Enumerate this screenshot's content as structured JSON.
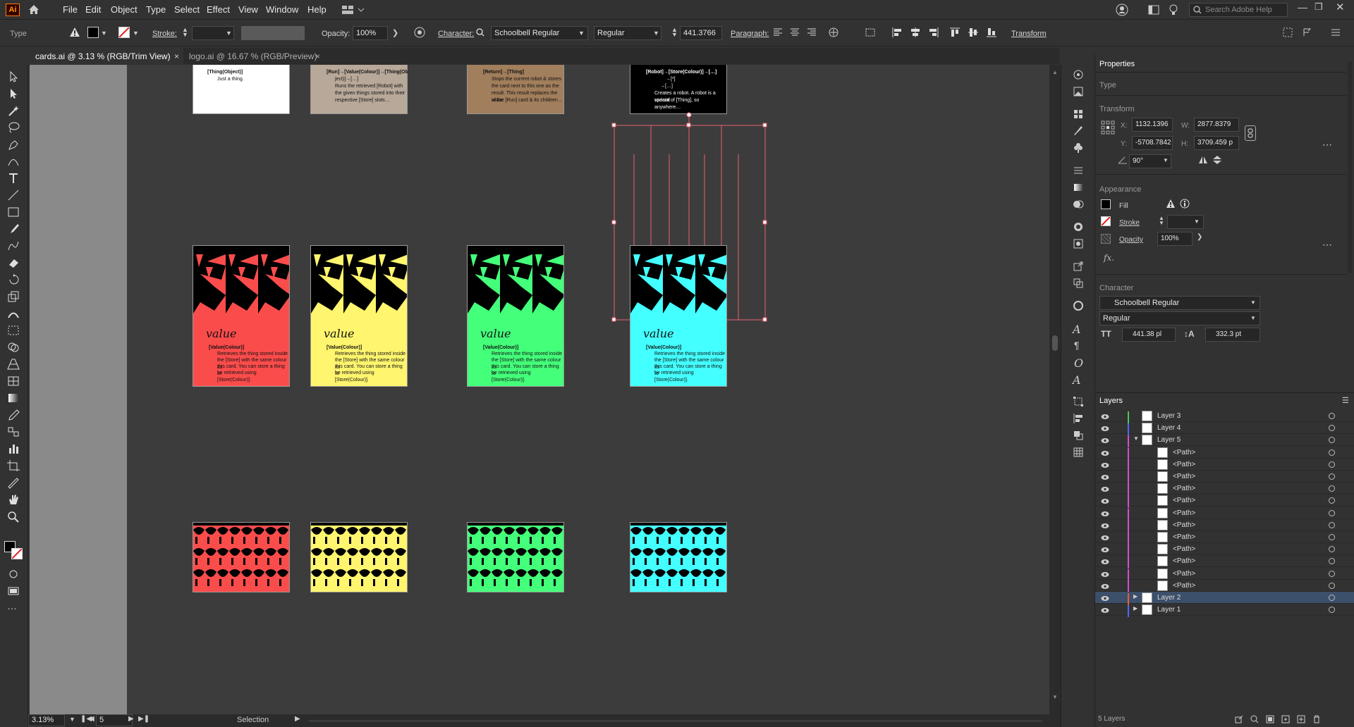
{
  "app": {
    "logo": "Ai",
    "home_icon": "home-icon"
  },
  "menu": [
    "File",
    "Edit",
    "Object",
    "Type",
    "Select",
    "Effect",
    "View",
    "Window",
    "Help"
  ],
  "search": {
    "placeholder": "Search Adobe Help"
  },
  "control": {
    "object_type": "Type",
    "stroke_label": "Stroke:",
    "opacity_label": "Opacity:",
    "opacity_value": "100%",
    "character_label": "Character:",
    "font_family": "Schoolbell Regular",
    "font_style": "Regular",
    "font_size": "441.3766",
    "paragraph_label": "Paragraph:",
    "transform_label": "Transform"
  },
  "tabs": [
    {
      "label": "cards.ai @ 3.13 % (RGB/Trim View)"
    },
    {
      "label": "logo.ai @ 16.67 % (RGB/Preview)"
    }
  ],
  "cards_top": [
    {
      "color": "#ffffff",
      "lines": [
        "[Thing(Object)]",
        "Just a thing."
      ]
    },
    {
      "color": "#b7a899",
      "lines": [
        "[Run]→[Value(Colour)]→[Thing(Ob",
        "ject)]→[…]",
        "Runs the retrieved [Robot] with",
        "the given things stored into their",
        "respective [Store] slots…"
      ]
    },
    {
      "color": "#a17e5c",
      "lines": [
        "[Return]→[Thing]",
        "Stops the current robot & stores",
        "the card next to this one as the",
        "result. This result replaces the value",
        "of the [Run] card & its children…"
      ]
    },
    {
      "color": "#000000",
      "lines": [
        "[Robot]→[Store(Colour)]→[…]",
        "→[*]",
        "→[…]",
        "Creates a robot. A robot is a special",
        "variant of [Thing], so anywhere…"
      ]
    }
  ],
  "cards_mid": [
    {
      "color": "#fb4c4c",
      "title": "value"
    },
    {
      "color": "#fff56e",
      "title": "value"
    },
    {
      "color": "#44ff7a",
      "title": "value"
    },
    {
      "color": "#44ffff",
      "title": "value"
    }
  ],
  "card_body": [
    "[Value(Colour)]",
    "Retrieves the thing stored inside",
    "the [Store] with the same colour as",
    "this card. You can store a thing to",
    "be retrieved using [Store(Colour)]."
  ],
  "status": {
    "zoom": "3.13%",
    "page": "5",
    "mode": "Selection"
  },
  "properties": {
    "title": "Properties",
    "type_label": "Type",
    "transform_label": "Transform",
    "x_label": "X:",
    "x": "1132.1396",
    "y_label": "Y:",
    "y": "-5708.7842",
    "w_label": "W:",
    "w": "2877.8379",
    "h_label": "H:",
    "h": "3709.459 p",
    "angle": "90°",
    "appearance_label": "Appearance",
    "fill_label": "Fill",
    "stroke_label": "Stroke",
    "opacity_label": "Opacity",
    "opacity_value": "100%",
    "fx_label": "fx.",
    "character_label": "Character",
    "font_family": "Schoolbell Regular",
    "font_style": "Regular",
    "font_size": "441.38 pl",
    "leading": "332.3 pt"
  },
  "layers": {
    "title": "Layers",
    "rows": [
      {
        "name": "Layer 3",
        "color": "#4ec94e"
      },
      {
        "name": "Layer 4",
        "color": "#4a6cf0"
      },
      {
        "name": "Layer 5",
        "color": "#d14fd1"
      },
      {
        "name": "<Path>",
        "color": "#d14fd1"
      },
      {
        "name": "<Path>",
        "color": "#d14fd1"
      },
      {
        "name": "<Path>",
        "color": "#d14fd1"
      },
      {
        "name": "<Path>",
        "color": "#d14fd1"
      },
      {
        "name": "<Path>",
        "color": "#d14fd1"
      },
      {
        "name": "<Path>",
        "color": "#d14fd1"
      },
      {
        "name": "<Path>",
        "color": "#d14fd1"
      },
      {
        "name": "<Path>",
        "color": "#d14fd1"
      },
      {
        "name": "<Path>",
        "color": "#d14fd1"
      },
      {
        "name": "<Path>",
        "color": "#d14fd1"
      },
      {
        "name": "<Path>",
        "color": "#d14fd1"
      },
      {
        "name": "<Path>",
        "color": "#d14fd1"
      },
      {
        "name": "Layer 2",
        "color": "#f05a3a"
      },
      {
        "name": "Layer 1",
        "color": "#4a6cf0"
      }
    ],
    "count_label": "5 Layers"
  }
}
